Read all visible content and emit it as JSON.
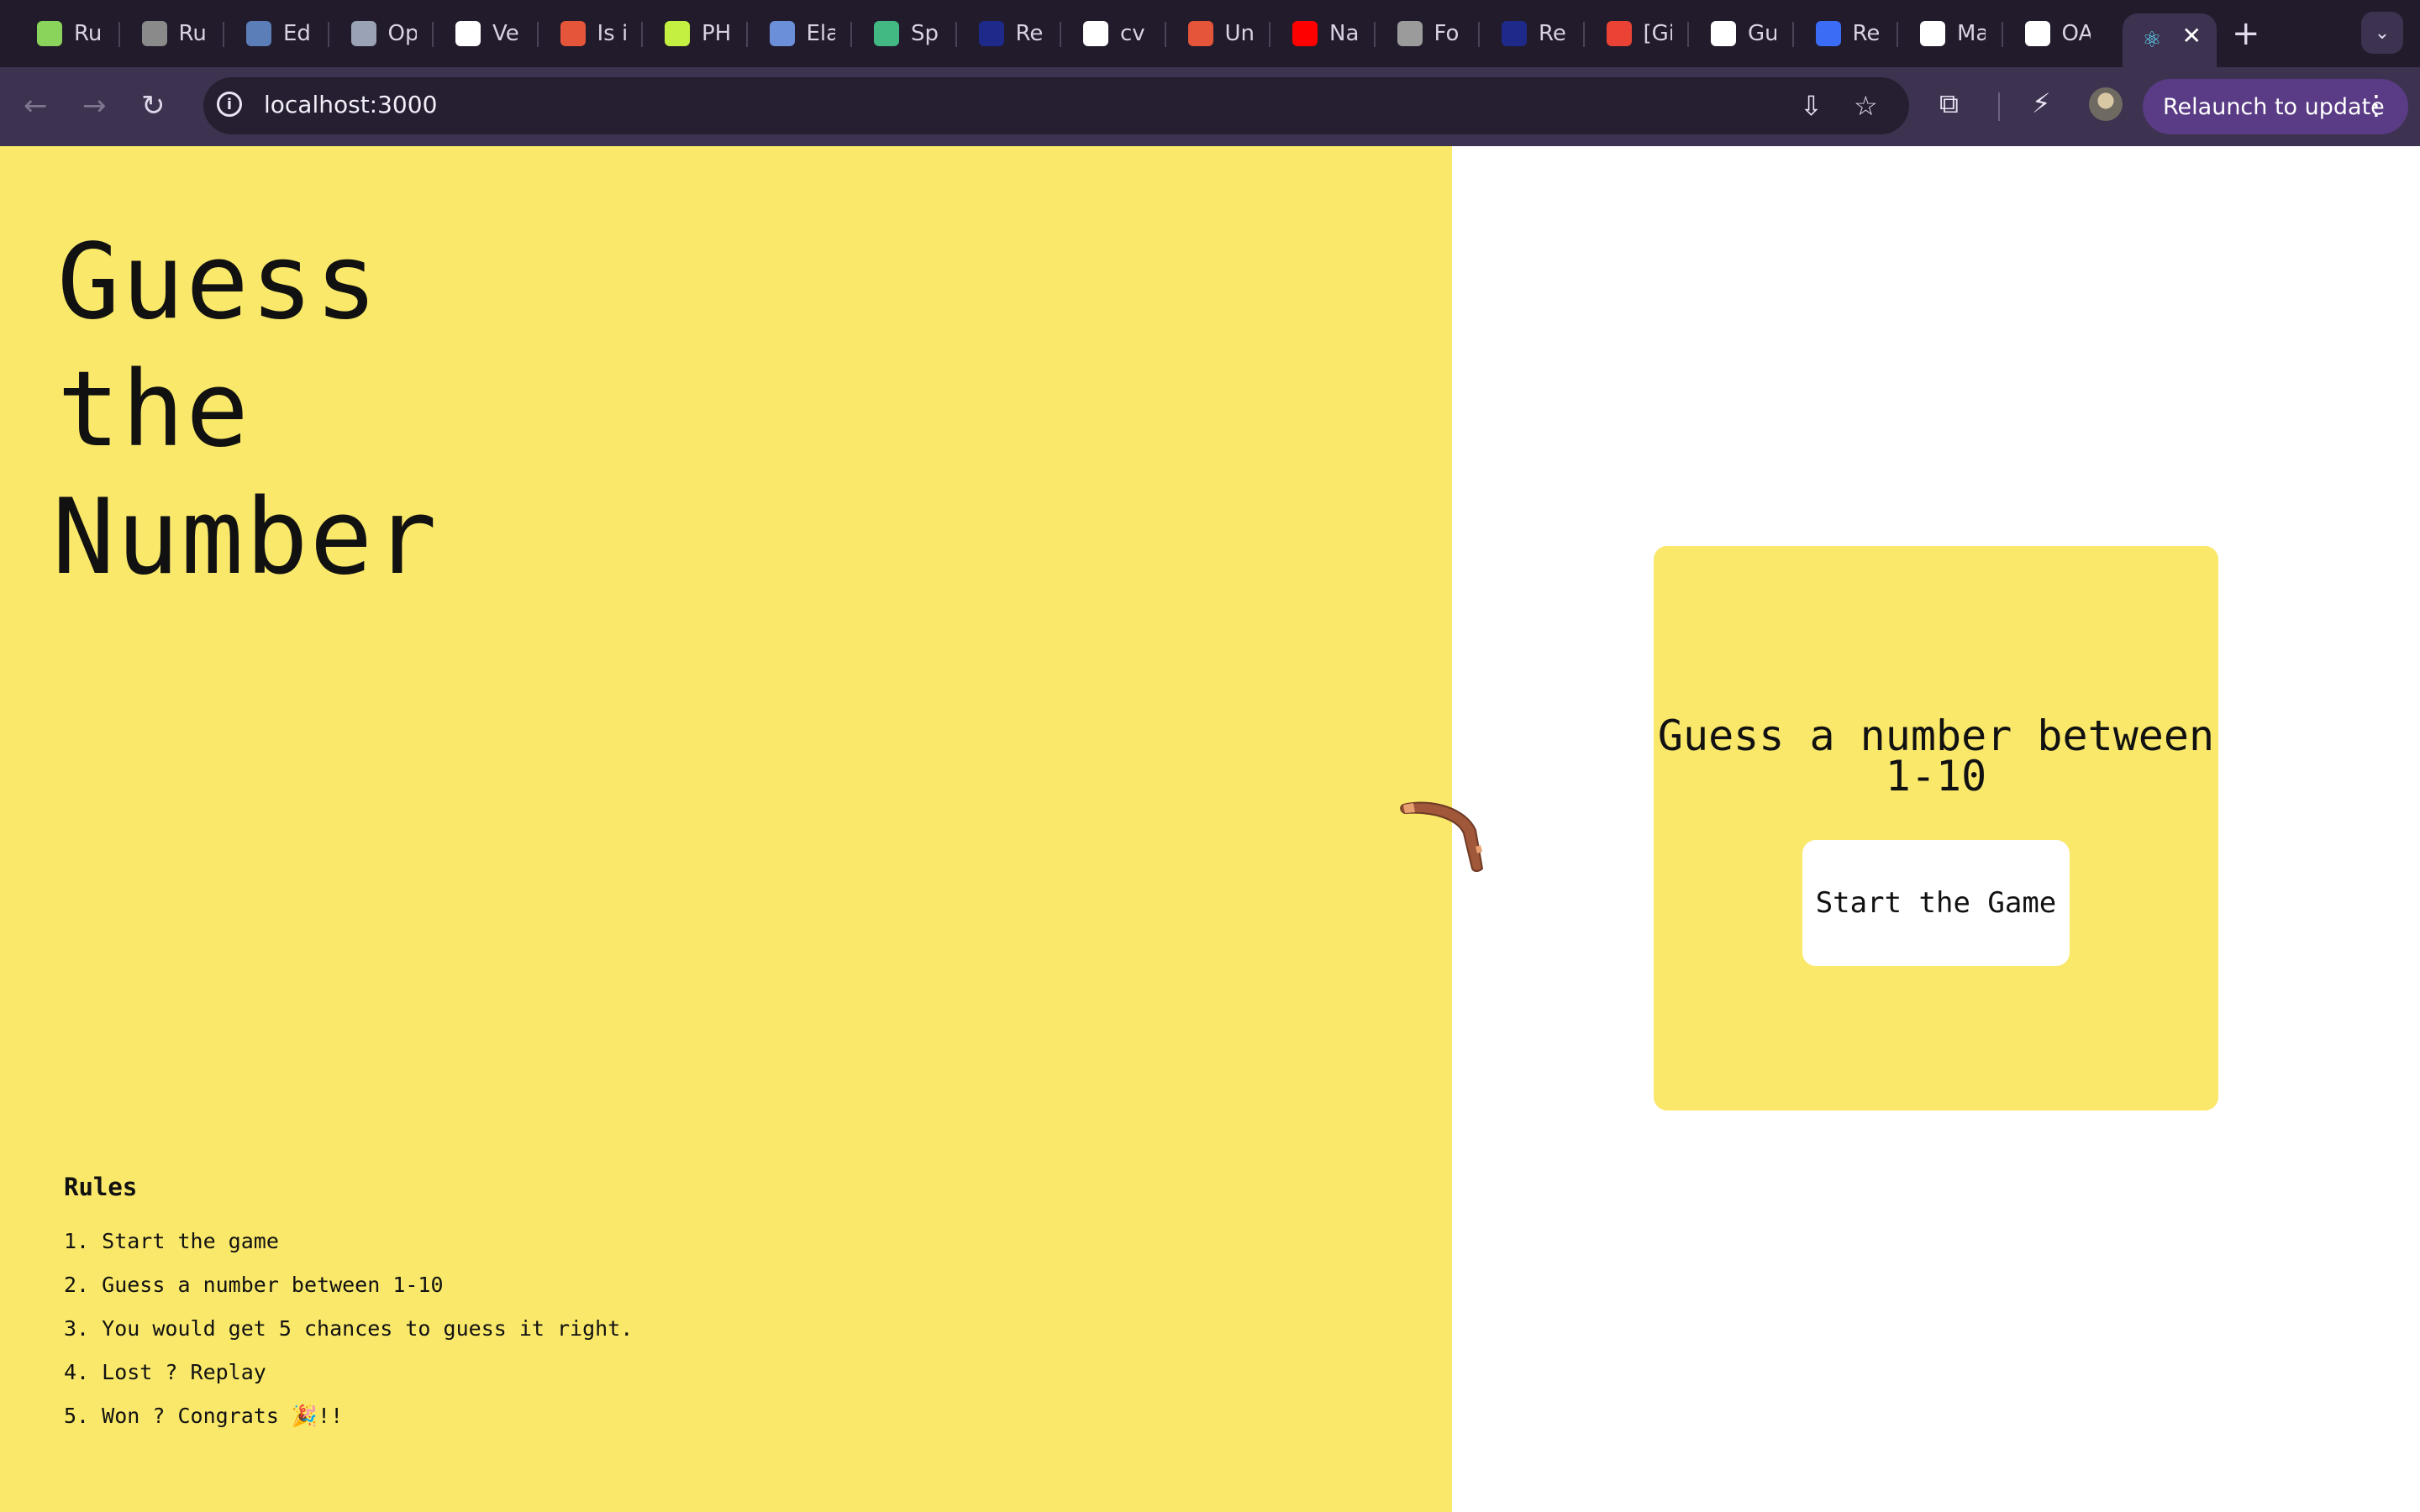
{
  "browser": {
    "tabs": [
      {
        "title": "Ru",
        "icon": "leaf-icon",
        "color": "#8bd45b"
      },
      {
        "title": "Ru",
        "icon": "globe-icon",
        "color": "#8a8a8a"
      },
      {
        "title": "Ed",
        "icon": "linkedin-circle-icon",
        "color": "#5b7db8"
      },
      {
        "title": "Op",
        "icon": "ih-icon",
        "color": "#9aa3b5"
      },
      {
        "title": "Ve",
        "icon": "openai-icon",
        "color": "#ffffff"
      },
      {
        "title": "Is i",
        "icon": "braces-icon",
        "color": "#e5553a"
      },
      {
        "title": "PH",
        "icon": "lambda-icon",
        "color": "#c4f041"
      },
      {
        "title": "Ela",
        "icon": "face-icon",
        "color": "#6b8fd8"
      },
      {
        "title": "Sp",
        "icon": "code-slash-icon",
        "color": "#42b883"
      },
      {
        "title": "Re",
        "icon": "r-logo-icon",
        "color": "#1e2a8a"
      },
      {
        "title": "cv",
        "icon": "google-icon",
        "color": "#ffffff"
      },
      {
        "title": "Un",
        "icon": "braces-icon",
        "color": "#e5553a"
      },
      {
        "title": "Na",
        "icon": "youtube-icon",
        "color": "#ff0000"
      },
      {
        "title": "Fo",
        "icon": "spiral-icon",
        "color": "#9b9b9b"
      },
      {
        "title": "Re",
        "icon": "r-logo-icon",
        "color": "#1e2a8a"
      },
      {
        "title": "[Gi",
        "icon": "gmail-icon",
        "color": "#ea4335"
      },
      {
        "title": "Gu",
        "icon": "github-icon",
        "color": "#ffffff"
      },
      {
        "title": "Re",
        "icon": "k-logo-icon",
        "color": "#3b6cf6"
      },
      {
        "title": "Ma",
        "icon": "github-icon",
        "color": "#ffffff"
      },
      {
        "title": "OA",
        "icon": "github-icon",
        "color": "#ffffff"
      }
    ],
    "active_tab": {
      "icon": "react-icon",
      "color": "#61dafb"
    },
    "url": "localhost:3000",
    "relaunch_label": "Relaunch to update"
  },
  "game": {
    "title_lines": [
      "Guess",
      "the",
      "Number"
    ],
    "card_heading": "Guess a number between 1-10",
    "start_button": "Start the Game",
    "rules_heading": "Rules",
    "rules": [
      "1. Start the game",
      "2. Guess a number between 1-10",
      "3. You would get 5 chances to guess it right.",
      "4. Lost ? Replay",
      "5. Won ? Congrats 🎉!!"
    ]
  },
  "colors": {
    "accent_yellow": "#f9e86a",
    "chrome_dark": "#221b2c",
    "chrome_toolbar": "#3d3350",
    "relaunch_purple": "#5a3b85"
  }
}
